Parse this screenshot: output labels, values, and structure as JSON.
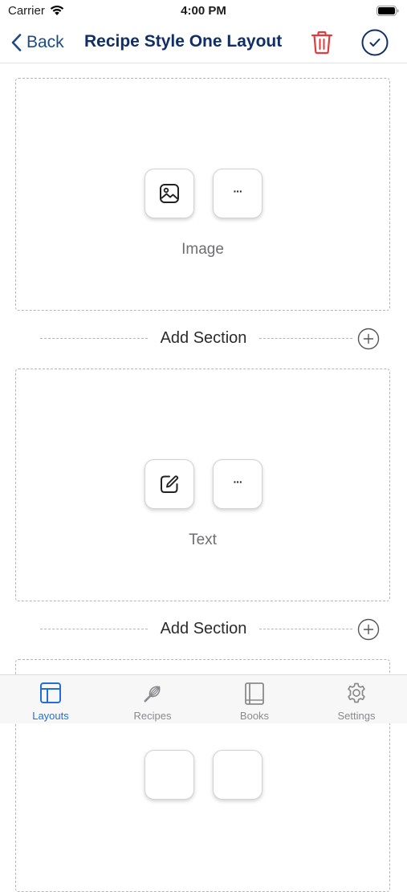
{
  "status_bar": {
    "carrier": "Carrier",
    "time": "4:00 PM"
  },
  "nav": {
    "back_label": "Back",
    "title": "Recipe Style One Layout"
  },
  "sections": [
    {
      "label": "Image",
      "primary_icon": "image-icon",
      "secondary_icon": "ellipsis-icon"
    },
    {
      "label": "Text",
      "primary_icon": "edit-icon",
      "secondary_icon": "ellipsis-icon"
    }
  ],
  "add_section_label": "Add Section",
  "more_glyph": "···",
  "tab_bar": {
    "active": "layouts",
    "tabs": [
      {
        "id": "layouts",
        "label": "Layouts",
        "icon": "layout-icon"
      },
      {
        "id": "recipes",
        "label": "Recipes",
        "icon": "whisk-icon"
      },
      {
        "id": "books",
        "label": "Books",
        "icon": "book-icon"
      },
      {
        "id": "settings",
        "label": "Settings",
        "icon": "gear-icon"
      }
    ]
  },
  "colors": {
    "accent": "#1f6fd6",
    "title": "#0f2f66",
    "delete": "#e23b3b",
    "dashed_border": "#b5b5b8"
  }
}
